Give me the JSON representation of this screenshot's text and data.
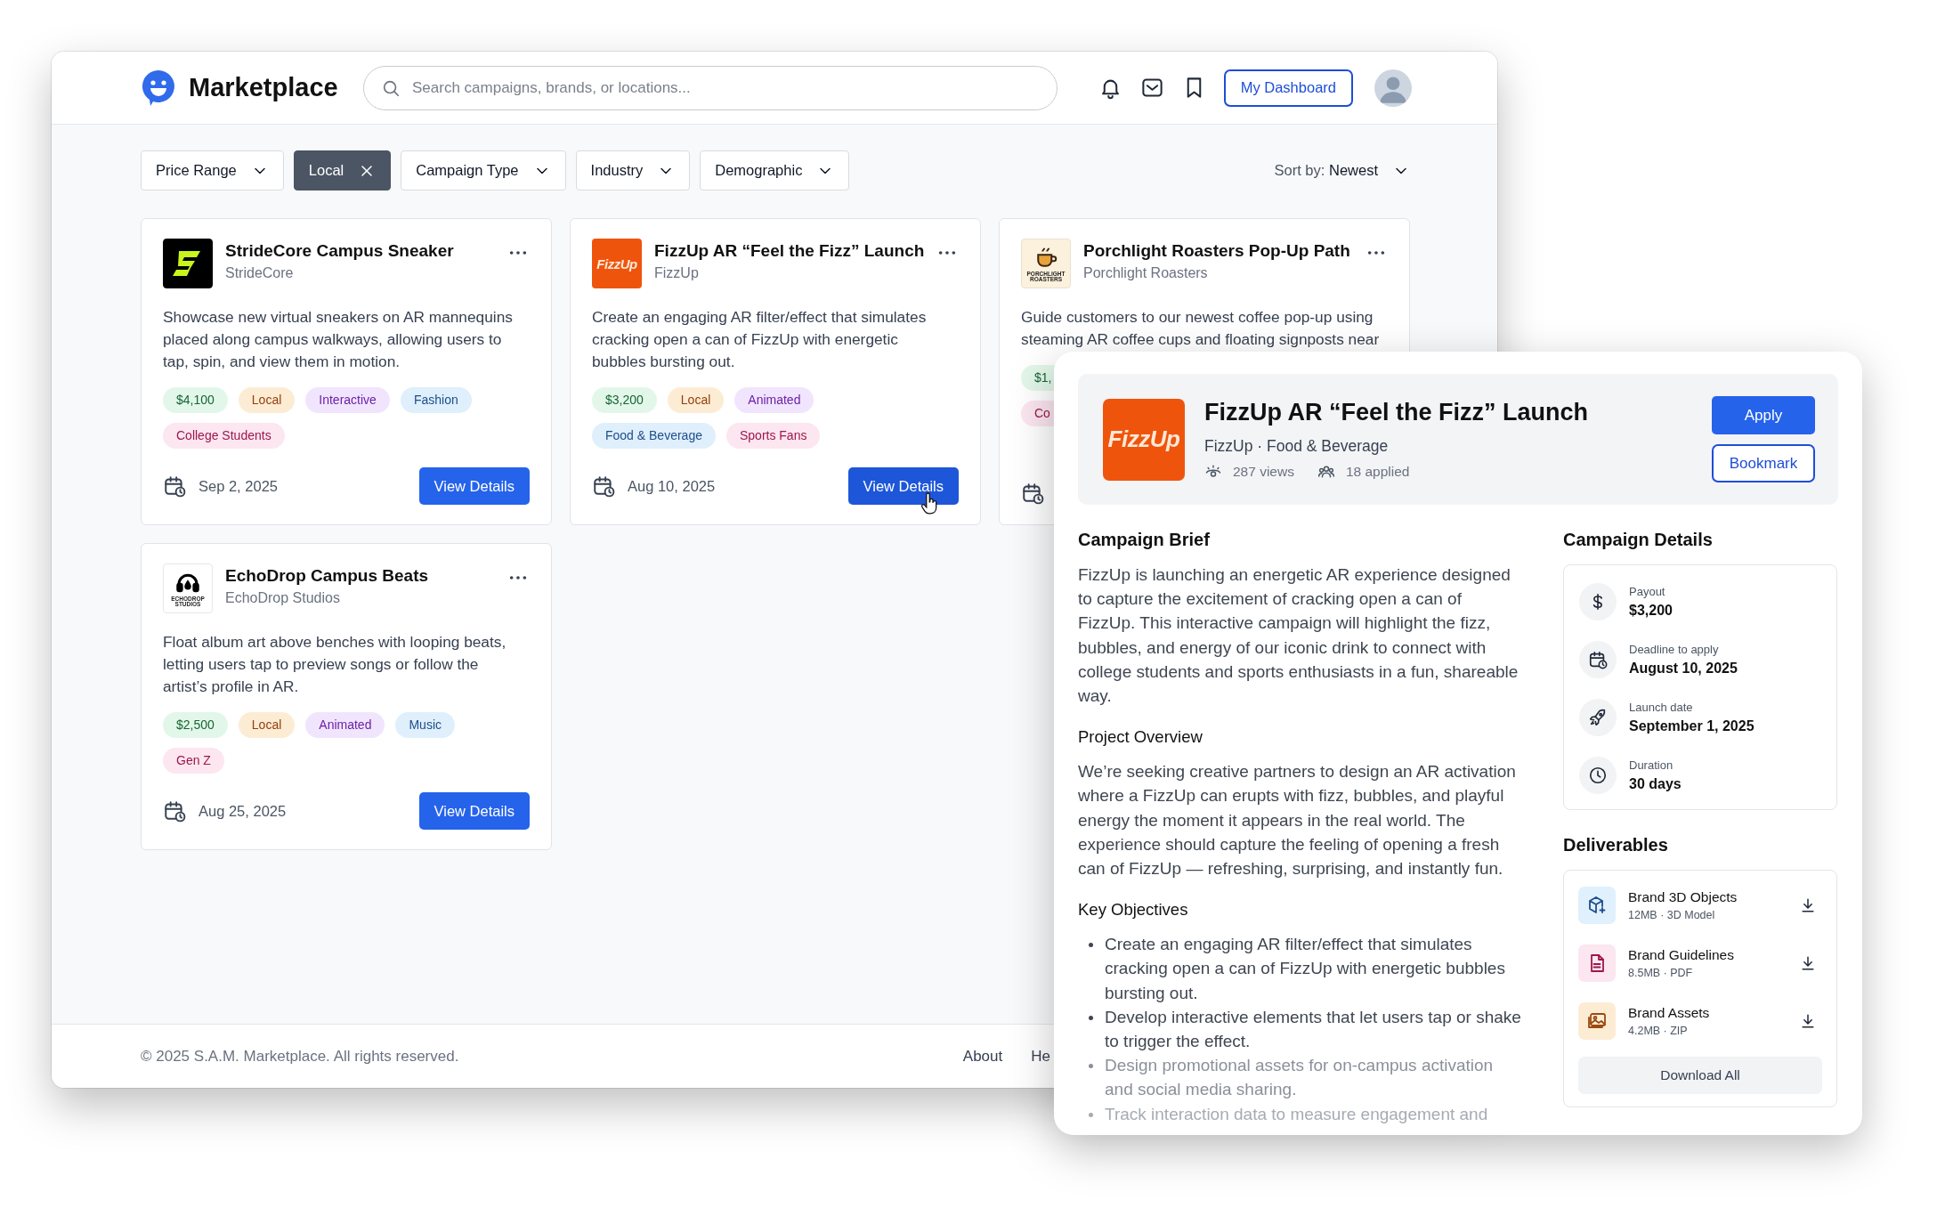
{
  "app": {
    "title": "Marketplace"
  },
  "search": {
    "placeholder": "Search campaigns, brands, or locations..."
  },
  "dashboard_button": "My Dashboard",
  "filters": [
    {
      "label": "Price Range",
      "selected": false
    },
    {
      "label": "Local",
      "selected": true
    },
    {
      "label": "Campaign Type",
      "selected": false
    },
    {
      "label": "Industry",
      "selected": false
    },
    {
      "label": "Demographic",
      "selected": false
    }
  ],
  "sort": {
    "label": "Sort by:",
    "value": "Newest"
  },
  "campaigns": [
    {
      "title": "StrideCore Campus Sneaker",
      "brand": "StrideCore",
      "logo": {
        "kind": "stride"
      },
      "description": "Showcase new virtual sneakers on AR mannequins placed along campus walkways, allowing users to tap, spin, and view them in motion.",
      "tag_rows": [
        [
          {
            "label": "$4,100",
            "kind": "price"
          },
          {
            "label": "Local",
            "kind": "location"
          },
          {
            "label": "Interactive",
            "kind": "type"
          },
          {
            "label": "Fashion",
            "kind": "industry"
          }
        ],
        [
          {
            "label": "College Students",
            "kind": "audience"
          }
        ]
      ],
      "date": "Sep 2, 2025",
      "button": "View Details"
    },
    {
      "title": "FizzUp AR “Feel the Fizz” Launch",
      "brand": "FizzUp",
      "logo": {
        "kind": "wordmark",
        "text": "FizzUp"
      },
      "description": "Create an engaging AR filter/effect that simulates cracking open a can of FizzUp with energetic bubbles bursting out.",
      "tag_rows": [
        [
          {
            "label": "$3,200",
            "kind": "price"
          },
          {
            "label": "Local",
            "kind": "location"
          },
          {
            "label": "Animated",
            "kind": "type"
          }
        ],
        [
          {
            "label": "Food & Beverage",
            "kind": "industry"
          },
          {
            "label": "Sports Fans",
            "kind": "audience"
          }
        ]
      ],
      "date": "Aug 10, 2025",
      "button": "View Details",
      "hovered": true
    },
    {
      "title": "Porchlight Roasters Pop-Up Path",
      "brand": "Porchlight Roasters",
      "logo": {
        "kind": "cup",
        "text": "PORCHLIGHT ROASTERS"
      },
      "description": "Guide customers to our newest coffee pop-up using steaming AR coffee cups and floating signposts near",
      "tag_rows": [
        [
          {
            "label": "$1,",
            "kind": "price"
          }
        ],
        [
          {
            "label": "Co",
            "kind": "audience"
          }
        ]
      ]
    },
    {
      "title": "EchoDrop Campus Beats",
      "brand": "EchoDrop Studios",
      "logo": {
        "kind": "headphones",
        "text": "ECHODROP STUDIOS"
      },
      "description": "Float album art above benches with looping beats, letting users tap to preview songs or follow the artist’s profile in AR.",
      "tag_rows": [
        [
          {
            "label": "$2,500",
            "kind": "price"
          },
          {
            "label": "Local",
            "kind": "location"
          },
          {
            "label": "Animated",
            "kind": "type"
          },
          {
            "label": "Music",
            "kind": "industry"
          }
        ],
        [
          {
            "label": "Gen Z",
            "kind": "audience"
          }
        ]
      ],
      "date": "Aug 25, 2025",
      "button": "View Details"
    }
  ],
  "footer": {
    "copyright": "© 2025 S.A.M. Marketplace. All rights reserved.",
    "links": [
      "About",
      "He"
    ]
  },
  "detail": {
    "title": "FizzUp AR “Feel the Fizz” Launch",
    "logo": {
      "kind": "wordmark",
      "text": "FizzUp"
    },
    "meta": "FizzUp · Food & Beverage",
    "views": "287 views",
    "applied": "18 applied",
    "apply_button": "Apply",
    "bookmark_button": "Bookmark",
    "brief": {
      "heading": "Campaign Brief",
      "text": "FizzUp is launching an energetic AR experience designed to capture the excitement of cracking open a can of FizzUp. This interactive campaign will highlight the fizz, bubbles, and energy of our iconic drink to connect with college students and sports enthusiasts in a fun, shareable way."
    },
    "overview": {
      "heading": "Project Overview",
      "text": "We’re seeking creative partners to design an AR activation where a FizzUp can erupts with fizz, bubbles, and playful energy the moment it appears in the real world. The experience should capture the feeling of opening a fresh can of FizzUp — refreshing, surprising, and instantly fun."
    },
    "objectives": {
      "heading": "Key Objectives",
      "items": [
        "Create an engaging AR filter/effect that simulates cracking open a can of FizzUp with energetic bubbles bursting out.",
        "Develop interactive elements that let users tap or shake to trigger the effect.",
        "Design promotional assets for on-campus activation and social media sharing.",
        "Track interaction data to measure engagement and"
      ]
    },
    "details": {
      "heading": "Campaign Details",
      "items": [
        {
          "label": "Payout",
          "value": "$3,200"
        },
        {
          "label": "Deadline to apply",
          "value": "August 10, 2025"
        },
        {
          "label": "Launch date",
          "value": "September 1, 2025"
        },
        {
          "label": "Duration",
          "value": "30 days"
        }
      ]
    },
    "deliverables": {
      "heading": "Deliverables",
      "items": [
        {
          "name": "Brand 3D Objects",
          "meta": "12MB · 3D Model"
        },
        {
          "name": "Brand Guidelines",
          "meta": "8.5MB · PDF"
        },
        {
          "name": "Brand Assets",
          "meta": "4.2MB · ZIP"
        }
      ],
      "button": "Download All"
    }
  }
}
